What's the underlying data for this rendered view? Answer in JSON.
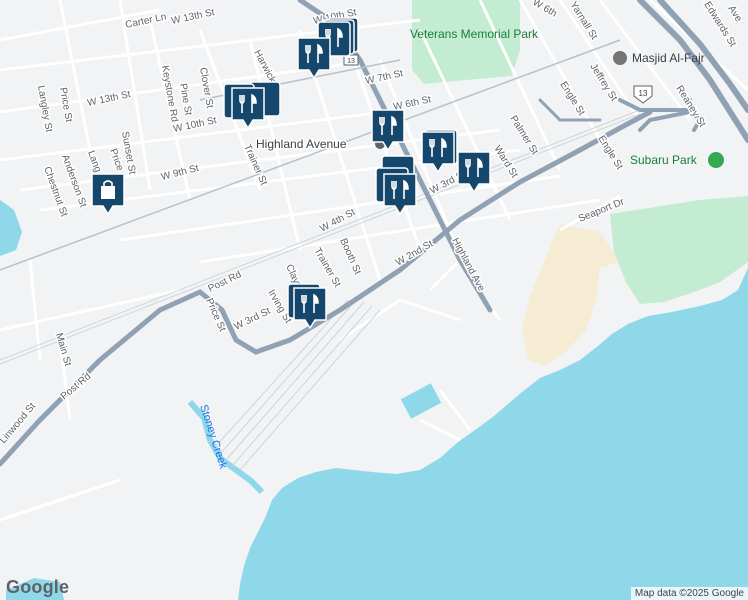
{
  "map": {
    "streets": [
      "Carter Ln",
      "W 13th St",
      "W 10th St",
      "Price St",
      "W 13th St",
      "Langley St",
      "Keystone Rd",
      "Pine St",
      "Clover St",
      "Harwick",
      "W 10th St",
      "W 7th St",
      "W 6th St",
      "Sunset St",
      "Anderson St",
      "Chestnut St",
      "Lang",
      "Price",
      "W 9th St",
      "Trainer St",
      "W 4th St",
      "W 3rd St",
      "Booth St",
      "Trainer St",
      "Post Rd",
      "Clayt",
      "Irving St",
      "W 3rd St",
      "W 2nd St",
      "Highland Ave",
      "Palmer St",
      "Ward St",
      "Engle St",
      "Engle St",
      "Jeffrey St",
      "Yarnall St",
      "Reaney St",
      "Seaport Dr",
      "Price St",
      "Main St",
      "Post Rd",
      "Linwood St",
      "W 6th",
      "Edwards St",
      "Ave"
    ],
    "places": {
      "park": "Veterans Memorial Park",
      "mosque": "Masjid Al-Fajr",
      "stadium": "Subaru Park",
      "station": "Highland Avenue",
      "creek": "Stoney Creek"
    },
    "route_shield": "13",
    "markers": [
      "restaurant",
      "restaurant",
      "restaurant",
      "restaurant",
      "restaurant",
      "restaurant",
      "restaurant",
      "restaurant",
      "shopping"
    ],
    "colors": {
      "water": "#8ed8ea",
      "park": "#c3ecd2",
      "major_road": "#8fa1b3",
      "land": "#f1f3f4",
      "marker": "#15466b"
    }
  },
  "footer": {
    "logo": "Google",
    "attribution": "Map data ©2025 Google"
  }
}
